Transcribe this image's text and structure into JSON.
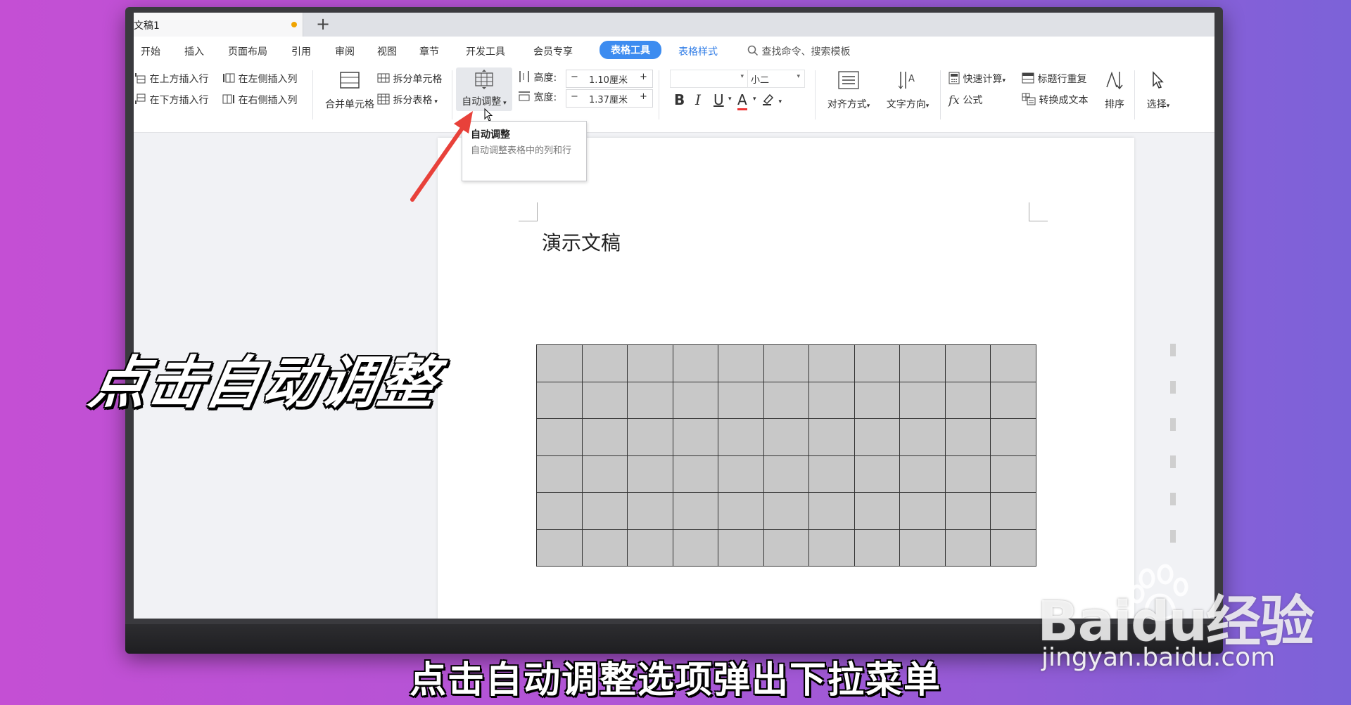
{
  "titlebar": {
    "doc_name": "文稿1",
    "new_tab": "+"
  },
  "menu": {
    "items": [
      "开始",
      "插入",
      "页面布局",
      "引用",
      "审阅",
      "视图",
      "章节",
      "开发工具",
      "会员专享"
    ],
    "active": "表格工具",
    "table_style": "表格样式",
    "search": "查找命令、搜索模板"
  },
  "ribbon": {
    "insert_above": "在上方插入行",
    "insert_below": "在下方插入行",
    "insert_left": "在左侧插入列",
    "insert_right": "在右侧插入列",
    "merge_cells": "合并单元格",
    "split_cells": "拆分单元格",
    "split_table": "拆分表格",
    "auto_adjust": "自动调整",
    "height_label": "高度:",
    "height_value": "1.10厘米",
    "width_label": "宽度:",
    "width_value": "1.37厘米",
    "font_size": "小二",
    "align": "对齐方式",
    "text_direction": "文字方向",
    "quick_calc": "快速计算",
    "formula": "公式",
    "header_repeat": "标题行重复",
    "to_text": "转换成文本",
    "sort": "排序",
    "select": "选择",
    "bold": "B",
    "italic": "I",
    "underline": "U",
    "font_color": "A",
    "minus": "−",
    "plus": "+"
  },
  "tooltip": {
    "title": "自动调整",
    "desc": "自动调整表格中的列和行"
  },
  "document": {
    "title": "演示文稿",
    "table_rows": 6,
    "table_cols": 11
  },
  "overlay": {
    "big_caption": "点击自动调整",
    "subtitle": "点击自动调整选项弹出下拉菜单",
    "watermark_logo": "Baidu经验",
    "watermark_url": "jingyan.baidu.com"
  },
  "colors": {
    "accent": "#3d8cf0",
    "arrow": "#e8413a",
    "cell": "#c8c8c8"
  }
}
